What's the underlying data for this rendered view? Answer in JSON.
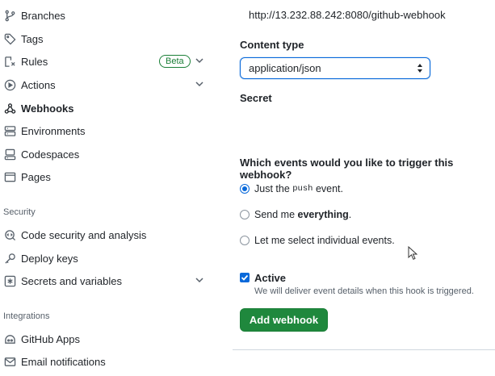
{
  "sidebar": {
    "items": [
      {
        "label": "Branches",
        "icon": "branch-icon"
      },
      {
        "label": "Tags",
        "icon": "tag-icon"
      },
      {
        "label": "Rules",
        "icon": "rules-icon",
        "badge": "Beta"
      },
      {
        "label": "Actions",
        "icon": "play-icon"
      },
      {
        "label": "Webhooks",
        "icon": "webhook-icon",
        "active": true
      },
      {
        "label": "Environments",
        "icon": "server-icon"
      },
      {
        "label": "Codespaces",
        "icon": "codespaces-icon"
      },
      {
        "label": "Pages",
        "icon": "browser-icon"
      }
    ],
    "security_heading": "Security",
    "security_items": [
      {
        "label": "Code security and analysis",
        "icon": "codescan-icon"
      },
      {
        "label": "Deploy keys",
        "icon": "key-icon"
      },
      {
        "label": "Secrets and variables",
        "icon": "asterisk-icon"
      }
    ],
    "integrations_heading": "Integrations",
    "integrations_items": [
      {
        "label": "GitHub Apps",
        "icon": "apps-icon"
      },
      {
        "label": "Email notifications",
        "icon": "mail-icon"
      }
    ]
  },
  "form": {
    "payload_url": "http://13.232.88.242:8080/github-webhook",
    "content_type_label": "Content type",
    "content_type_value": "application/json",
    "secret_label": "Secret",
    "events_question": "Which events would you like to trigger this webhook?",
    "event_options": {
      "push_prefix": "Just the ",
      "push_code": "push",
      "push_suffix": " event.",
      "everything_prefix": "Send me ",
      "everything_bold": "everything",
      "everything_suffix": ".",
      "individual": "Let me select individual events."
    },
    "selected_event": "push",
    "active_label": "Active",
    "active_checked": true,
    "active_hint": "We will deliver event details when this hook is triggered.",
    "submit_label": "Add webhook"
  },
  "colors": {
    "primary_button": "#1f883d",
    "accent_blue": "#0969da",
    "beta_green": "#1a7f37"
  }
}
